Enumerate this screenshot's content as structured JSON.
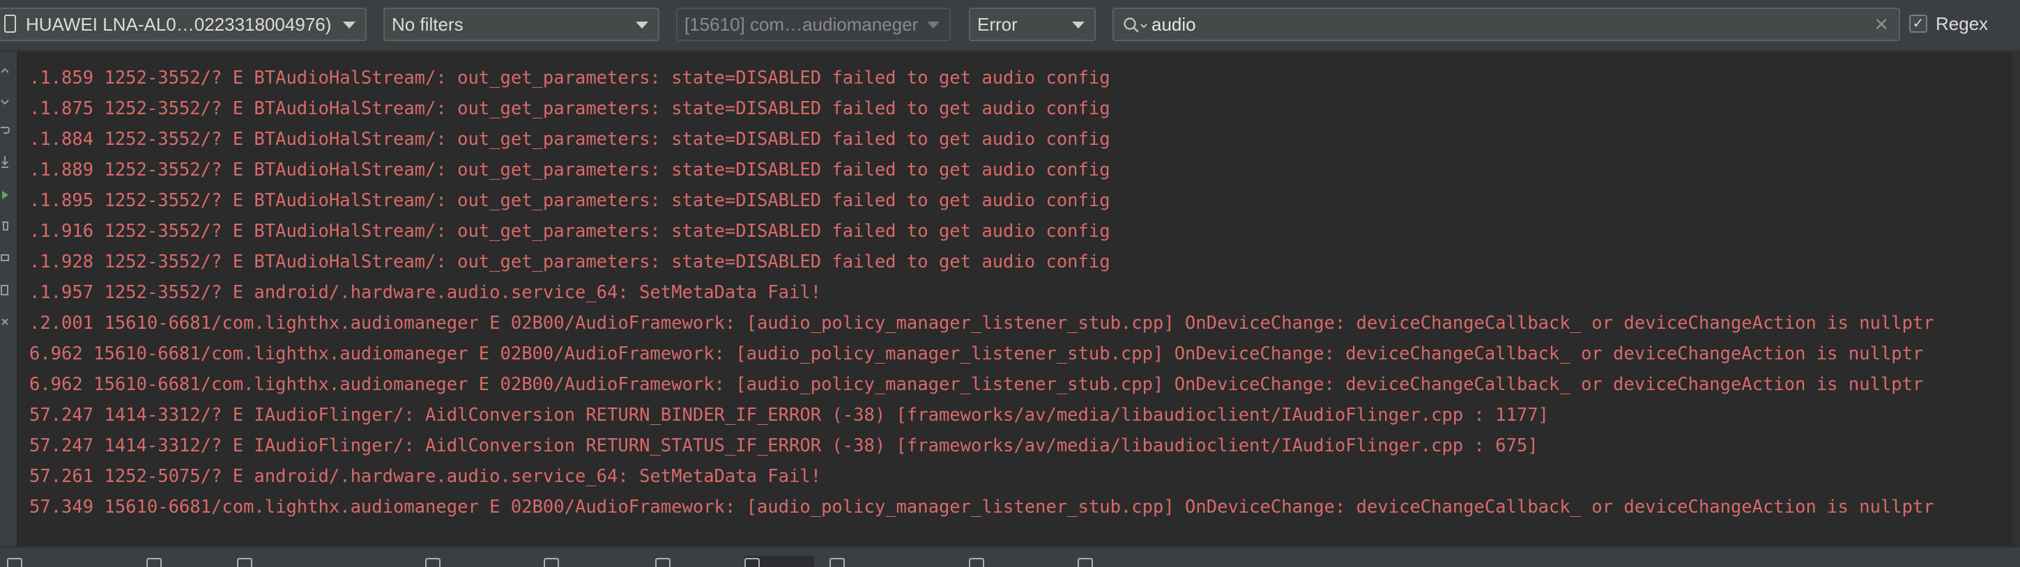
{
  "toolbar": {
    "device": {
      "label": "HUAWEI LNA-AL0…0223318004976)"
    },
    "filter": {
      "label": "No filters"
    },
    "process": {
      "label": "[15610] com…audiomaneger"
    },
    "level": {
      "label": "Error"
    },
    "search": {
      "value": "audio"
    },
    "regex": {
      "label": "Regex",
      "checked": true,
      "check_glyph": "✓"
    },
    "clear_glyph": "✕"
  },
  "log_lines": [
    ".1.859 1252-3552/? E BTAudioHalStream/: out_get_parameters: state=DISABLED failed to get audio config",
    ".1.875 1252-3552/? E BTAudioHalStream/: out_get_parameters: state=DISABLED failed to get audio config",
    ".1.884 1252-3552/? E BTAudioHalStream/: out_get_parameters: state=DISABLED failed to get audio config",
    ".1.889 1252-3552/? E BTAudioHalStream/: out_get_parameters: state=DISABLED failed to get audio config",
    ".1.895 1252-3552/? E BTAudioHalStream/: out_get_parameters: state=DISABLED failed to get audio config",
    ".1.916 1252-3552/? E BTAudioHalStream/: out_get_parameters: state=DISABLED failed to get audio config",
    ".1.928 1252-3552/? E BTAudioHalStream/: out_get_parameters: state=DISABLED failed to get audio config",
    ".1.957 1252-3552/? E android/.hardware.audio.service_64: SetMetaData Fail!",
    ".2.001 15610-6681/com.lighthx.audiomaneger E 02B00/AudioFramework: [audio_policy_manager_listener_stub.cpp] OnDeviceChange: deviceChangeCallback_ or deviceChangeAction is nullptr",
    "6.962 15610-6681/com.lighthx.audiomaneger E 02B00/AudioFramework: [audio_policy_manager_listener_stub.cpp] OnDeviceChange: deviceChangeCallback_ or deviceChangeAction is nullptr",
    "6.962 15610-6681/com.lighthx.audiomaneger E 02B00/AudioFramework: [audio_policy_manager_listener_stub.cpp] OnDeviceChange: deviceChangeCallback_ or deviceChangeAction is nullptr",
    "57.247 1414-3312/? E IAudioFlinger/: AidlConversion RETURN_BINDER_IF_ERROR (-38) [frameworks/av/media/libaudioclient/IAudioFlinger.cpp : 1177]",
    "57.247 1414-3312/? E IAudioFlinger/: AidlConversion RETURN_STATUS_IF_ERROR (-38) [frameworks/av/media/libaudioclient/IAudioFlinger.cpp : 675]",
    "57.261 1252-5075/? E android/.hardware.audio.service_64: SetMetaData Fail!",
    "57.349 15610-6681/com.lighthx.audiomaneger E 02B00/AudioFramework: [audio_policy_manager_listener_stub.cpp] OnDeviceChange: deviceChangeCallback_ or deviceChangeAction is nullptr"
  ],
  "colors": {
    "error_text": "#d96a6a",
    "log_background": "#2b2b2b",
    "toolbar_background": "#3c3f41"
  },
  "icons": {
    "device": "phone-icon",
    "search": "search-icon",
    "clear": "close-icon",
    "sidebar": [
      "scroll-up-icon",
      "scroll-down-icon",
      "soft-wrap-icon",
      "scroll-to-end-icon",
      "restart-icon",
      "clear-log-icon",
      "print-icon",
      "screenshot-icon",
      "more-icon"
    ]
  }
}
